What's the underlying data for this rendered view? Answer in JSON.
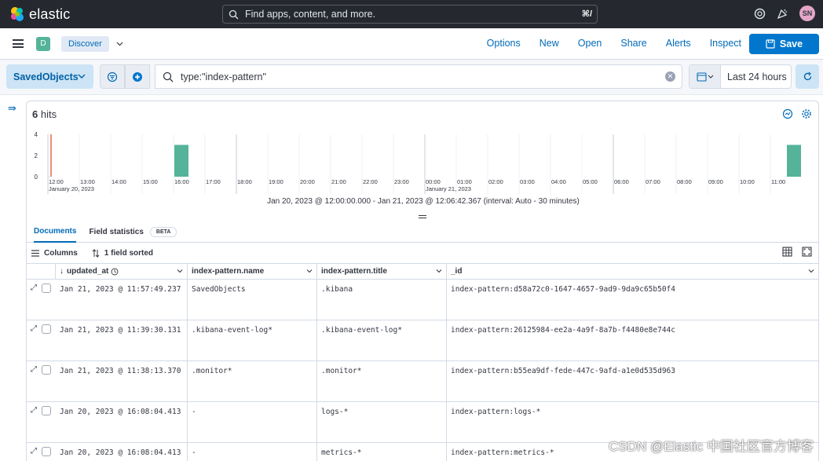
{
  "header": {
    "brand": "elastic",
    "search_placeholder": "Find apps, content, and more.",
    "search_shortcut": "⌘/",
    "avatar_initials": "SN"
  },
  "appbar": {
    "space_initial": "D",
    "breadcrumb": "Discover",
    "menu": [
      "Options",
      "New",
      "Open",
      "Share",
      "Alerts",
      "Inspect"
    ],
    "save_label": "Save"
  },
  "querybar": {
    "data_view": "SavedObjects",
    "query": "type:\"index-pattern\"",
    "time_range": "Last 24 hours"
  },
  "results": {
    "hits_count": "6",
    "hits_label": "hits",
    "interval_caption": "Jan 20, 2023 @ 12:00:00.000 - Jan 21, 2023 @ 12:06:42.367 (interval: Auto - 30 minutes)"
  },
  "chart_data": {
    "type": "bar",
    "y_ticks": [
      "4",
      "2",
      "0"
    ],
    "ylim": [
      0,
      4
    ],
    "x_ticks": [
      "12:00",
      "13:00",
      "14:00",
      "15:00",
      "16:00",
      "17:00",
      "18:00",
      "19:00",
      "20:00",
      "21:00",
      "22:00",
      "23:00",
      "00:00",
      "01:00",
      "02:00",
      "03:00",
      "04:00",
      "05:00",
      "06:00",
      "07:00",
      "08:00",
      "09:00",
      "10:00",
      "11:00"
    ],
    "date_labels": [
      {
        "text": "January 20, 2023",
        "at_tick": "12:00"
      },
      {
        "text": "January 21, 2023",
        "at_tick": "00:00"
      }
    ],
    "bars": [
      {
        "x": "16:00",
        "value": 3
      },
      {
        "x": "11:30",
        "value": 3
      }
    ],
    "bar_color": "#54b399",
    "now_marker": "12:06"
  },
  "tabs": {
    "documents": "Documents",
    "field_statistics": "Field statistics",
    "beta": "BETA"
  },
  "toolbar": {
    "columns": "Columns",
    "sorted": "1 field sorted"
  },
  "table": {
    "columns": [
      "updated_at",
      "index-pattern.name",
      "index-pattern.title",
      "_id"
    ],
    "rows": [
      [
        "Jan 21, 2023 @ 11:57:49.237",
        "SavedObjects",
        ".kibana",
        "index-pattern:d58a72c0-1647-4657-9ad9-9da9c65b50f4"
      ],
      [
        "Jan 21, 2023 @ 11:39:30.131",
        ".kibana-event-log*",
        ".kibana-event-log*",
        "index-pattern:26125984-ee2a-4a9f-8a7b-f4480e8e744c"
      ],
      [
        "Jan 21, 2023 @ 11:38:13.370",
        ".monitor*",
        ".monitor*",
        "index-pattern:b55ea9df-fede-447c-9afd-a1e0d535d963"
      ],
      [
        "Jan 20, 2023 @ 16:08:04.413",
        " -",
        "logs-*",
        "index-pattern:logs-*"
      ],
      [
        "Jan 20, 2023 @ 16:08:04.413",
        " -",
        "metrics-*",
        "index-pattern:metrics-*"
      ]
    ]
  },
  "watermark": "CSDN @Elastic 中国社区官方博客"
}
